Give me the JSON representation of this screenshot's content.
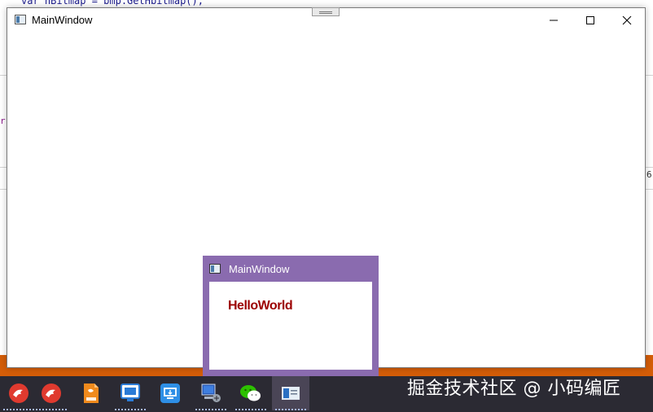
{
  "background": {
    "code_line": "var hBitmap = bmp.GetHbitmap();",
    "left_fragment": "r",
    "right_fragment": "6"
  },
  "main_window": {
    "title": "MainWindow",
    "icon": "wpf-window-icon",
    "buttons": {
      "minimize": "minimize-icon",
      "maximize": "maximize-icon",
      "close": "close-icon"
    }
  },
  "thumbnail": {
    "title": "MainWindow",
    "content_text": "HelloWorld",
    "text_color": "#9c0000",
    "frame_color": "#8a6baf"
  },
  "taskbar": {
    "items": [
      {
        "name": "app-red-bird-icon",
        "active": false
      },
      {
        "name": "app-red-bird-2-icon",
        "active": false
      },
      {
        "name": "app-orange-document-icon",
        "active": false
      },
      {
        "name": "app-presentation-icon",
        "active": false
      },
      {
        "name": "app-remote-desktop-icon",
        "active": false
      },
      {
        "name": "app-network-computer-icon",
        "active": false
      },
      {
        "name": "app-wechat-icon",
        "active": false
      },
      {
        "name": "app-mainwindow-icon",
        "active": true
      }
    ],
    "watermark": "掘金技术社区 @ 小码编匠"
  },
  "colors": {
    "taskbar_bg": "#2b2a33",
    "accent_orange": "#d45d08"
  }
}
